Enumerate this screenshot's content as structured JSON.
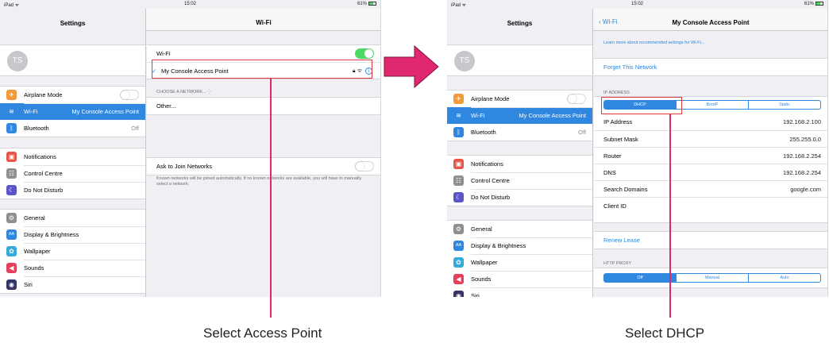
{
  "colors": {
    "accent": "#2f87e0",
    "arrow": "#e0286e",
    "highlight": "#e0393e",
    "toggle_on": "#4cd964"
  },
  "left": {
    "status": {
      "device": "iPad ᯤ",
      "time": "15:02",
      "battery": "61%"
    },
    "sidebar_title": "Settings",
    "avatar_initials": "TS",
    "groups": [
      [
        {
          "icon": "airplane-icon",
          "glyph": "✈",
          "color": "#f19a37",
          "label": "Airplane Mode",
          "value": "",
          "toggle": "off"
        },
        {
          "icon": "wifi-icon",
          "glyph": "≋",
          "color": "#2f87e0",
          "label": "Wi-Fi",
          "value": "My Console Access Point",
          "selected": true
        },
        {
          "icon": "bluetooth-icon",
          "glyph": "ᛒ",
          "color": "#2f87e0",
          "label": "Bluetooth",
          "value": "Off"
        }
      ],
      [
        {
          "icon": "notifications-icon",
          "glyph": "▣",
          "color": "#e85447",
          "label": "Notifications",
          "value": ""
        },
        {
          "icon": "control-centre-icon",
          "glyph": "☷",
          "color": "#8e8e93",
          "label": "Control Centre",
          "value": ""
        },
        {
          "icon": "do-not-disturb-icon",
          "glyph": "☾",
          "color": "#5b55c9",
          "label": "Do Not Disturb",
          "value": ""
        }
      ],
      [
        {
          "icon": "general-icon",
          "glyph": "⚙",
          "color": "#8e8e93",
          "label": "General",
          "value": ""
        },
        {
          "icon": "display-icon",
          "glyph": "AA",
          "color": "#2f87e0",
          "label": "Display & Brightness",
          "value": ""
        },
        {
          "icon": "wallpaper-icon",
          "glyph": "✿",
          "color": "#35aadc",
          "label": "Wallpaper",
          "value": ""
        },
        {
          "icon": "sounds-icon",
          "glyph": "◀",
          "color": "#e8405c",
          "label": "Sounds",
          "value": ""
        },
        {
          "icon": "siri-icon",
          "glyph": "◉",
          "color": "#333366",
          "label": "Siri",
          "value": ""
        }
      ]
    ],
    "detail_title": "Wi-Fi",
    "wifi_label": "Wi-Fi",
    "current_network": "My Console Access Point",
    "choose_header": "CHOOSE A NETWORK...",
    "other_label": "Other...",
    "ask_label": "Ask to Join Networks",
    "ask_footnote": "Known networks will be joined automatically. If no known networks are available, you will have to manually select a network."
  },
  "right": {
    "status": {
      "device": "iPad ᯤ",
      "time": "15:02",
      "battery": "61%"
    },
    "sidebar_title": "Settings",
    "back_label": "Wi-Fi",
    "detail_title": "My Console Access Point",
    "learn_more": "Learn more about recommended settings for Wi-Fi...",
    "forget_label": "Forget This Network",
    "ip_header": "IP ADDRESS",
    "ip_modes": [
      "DHCP",
      "BootP",
      "Static"
    ],
    "ip_rows": [
      {
        "label": "IP Address",
        "value": "192.168.2.100"
      },
      {
        "label": "Subnet Mask",
        "value": "255.255.0.0"
      },
      {
        "label": "Router",
        "value": "192.168.2.254"
      },
      {
        "label": "DNS",
        "value": "192.168.2.254"
      },
      {
        "label": "Search Domains",
        "value": "google.com"
      },
      {
        "label": "Client ID",
        "value": ""
      }
    ],
    "renew_label": "Renew Lease",
    "proxy_header": "HTTP PROXY",
    "proxy_modes": [
      "Off",
      "Manual",
      "Auto"
    ]
  },
  "captions": {
    "left": "Select Access Point",
    "right": "Select DHCP"
  }
}
